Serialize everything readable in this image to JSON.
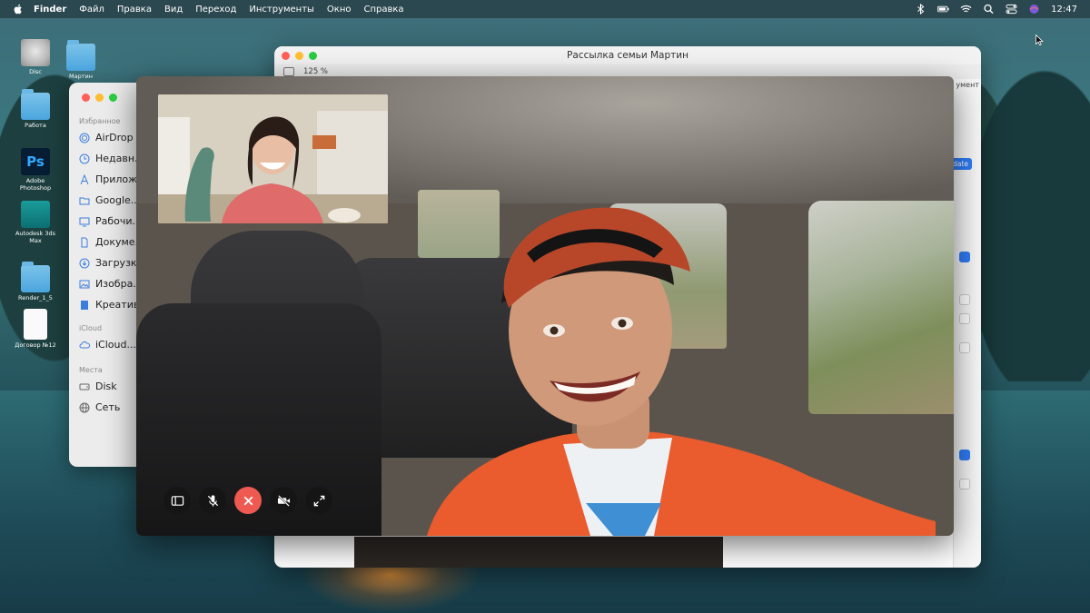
{
  "menubar": {
    "app": "Finder",
    "items": [
      "Файл",
      "Правка",
      "Вид",
      "Переход",
      "Инструменты",
      "Окно",
      "Справка"
    ],
    "clock": "12:47"
  },
  "desktop_icons": [
    {
      "label": "Disc",
      "icon": "disk-icon"
    },
    {
      "label": "Мартин",
      "icon": "folder-icon"
    },
    {
      "label": "Работа",
      "icon": "folder-icon"
    },
    {
      "label": "Adobe Photoshop",
      "icon": "photoshop-icon"
    },
    {
      "label": "Autodesk 3ds Max",
      "icon": "3dsmax-icon"
    },
    {
      "label": "Render_1_5",
      "icon": "folder-icon"
    },
    {
      "label": "Договор №12",
      "icon": "document-icon"
    }
  ],
  "pages_window": {
    "title": "Рассылка семьи Мартин",
    "zoom": "125 %",
    "panel_label": "умент",
    "update_button": "date"
  },
  "finder": {
    "favorites_header": "Избранное",
    "favorites": [
      "AirDrop",
      "Недавн...",
      "Прилож...",
      "Google...",
      "Рабочи...",
      "Докуме...",
      "Загрузк...",
      "Изобра...",
      "Креатив"
    ],
    "icloud_header": "iCloud",
    "icloud": [
      "iCloud..."
    ],
    "places_header": "Места",
    "places": [
      "Disk",
      "Сеть"
    ]
  },
  "facetime": {
    "controls": [
      "sidebar-toggle",
      "mute",
      "end-call",
      "video-off",
      "fullscreen"
    ],
    "colors": {
      "end": "#ee5a52",
      "shirt": "#ea5b2d"
    }
  }
}
